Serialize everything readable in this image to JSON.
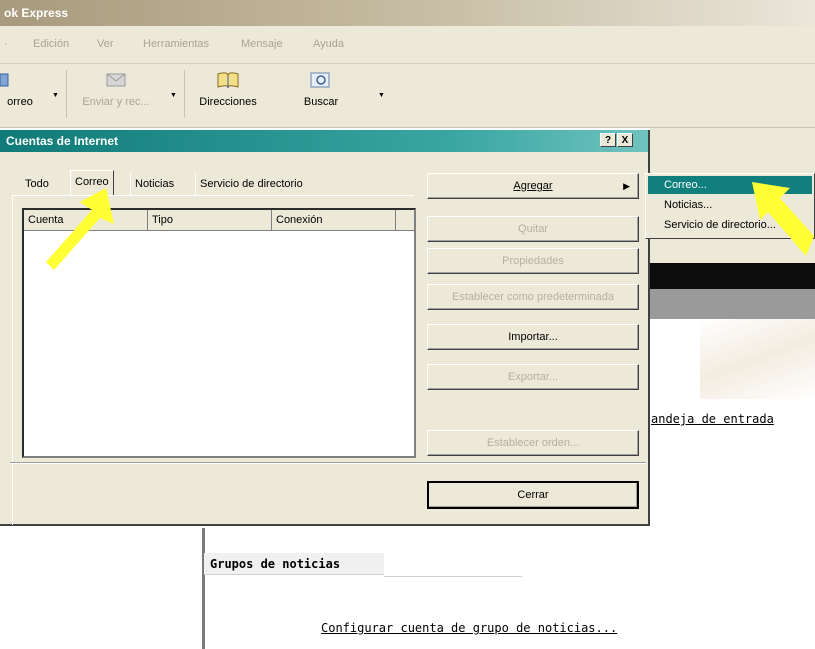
{
  "app": {
    "title": "ok Express"
  },
  "menu": [
    "Edición",
    "Ver",
    "Herramientas",
    "Mensaje",
    "Ayuda"
  ],
  "toolbar": {
    "mail_label": "orreo",
    "send_receive_label": "Enviar y rec...",
    "addresses_label": "Direcciones",
    "find_label": "Buscar"
  },
  "dialog": {
    "title": "Cuentas de Internet",
    "help_btn": "?",
    "close_btn": "X",
    "tabs": [
      "Todo",
      "Correo",
      "Noticias",
      "Servicio de directorio"
    ],
    "columns": [
      "Cuenta",
      "Tipo",
      "Conexión"
    ],
    "buttons": {
      "add": "Agregar",
      "remove": "Quitar",
      "properties": "Propiedades",
      "set_default": "Establecer como predeterminada",
      "import": "Importar...",
      "export": "Exportar...",
      "set_order": "Establecer orden...",
      "close": "Cerrar"
    }
  },
  "submenu": [
    "Correo...",
    "Noticias...",
    "Servicio de directorio..."
  ],
  "content": {
    "inbox_link": "andeja de entrada",
    "news_heading": "Grupos de noticias",
    "news_link": "Configurar cuenta de grupo de noticias..."
  },
  "colors": {
    "highlight": "#11807d",
    "annotation_arrow": "#ffff33"
  }
}
